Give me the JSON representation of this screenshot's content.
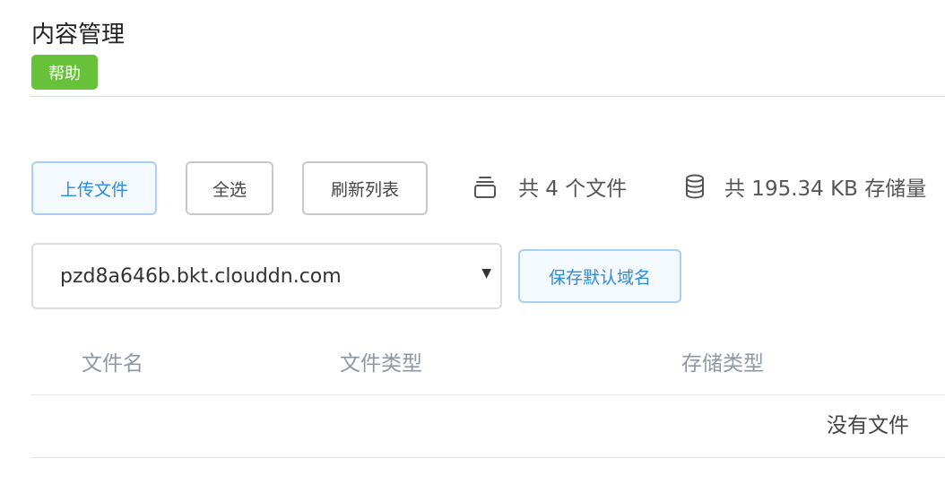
{
  "page": {
    "title": "内容管理",
    "help_label": "帮助"
  },
  "toolbar": {
    "upload_label": "上传文件",
    "select_all_label": "全选",
    "refresh_label": "刷新列表"
  },
  "stats": {
    "files_icon": "layers-icon",
    "files_text": "共 4 个文件",
    "storage_icon": "database-icon",
    "storage_text": "共 195.34 KB 存储量"
  },
  "domain": {
    "selected_value": "pzd8a646b.bkt.clouddn.com",
    "save_label": "保存默认域名"
  },
  "table": {
    "columns": [
      "文件名",
      "文件类型",
      "存储类型"
    ],
    "empty_text": "没有文件"
  },
  "colors": {
    "help_badge": "#67c23a",
    "primary_text": "#2f8ae0",
    "primary_border": "#a9cff4",
    "header_text": "#8d97a5"
  }
}
